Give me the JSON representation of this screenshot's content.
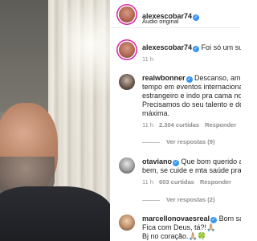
{
  "post": {
    "username": "alexescobar74",
    "subtitle": "Áudio original"
  },
  "comments": [
    {
      "username": "alexescobar74",
      "verified": true,
      "text": "Foi só um sus",
      "time": "11 h"
    },
    {
      "username": "realwbonner",
      "verified": true,
      "text_first": "Descanso, amig",
      "lines": [
        "tempo em eventos internacional",
        "estrangeiro e indo pra cama no",
        "Precisamos do seu talento e do",
        "máxima."
      ],
      "time": "11 h",
      "likes": "2.304 curtidas",
      "reply": "Responder",
      "view_replies": "Ver respostas (9)"
    },
    {
      "username": "otaviano",
      "verified": true,
      "text_first": "Que bom querido ar",
      "lines": [
        "bem, se cuide e mta saúde pra v"
      ],
      "time": "11 h",
      "likes": "603 curtidas",
      "reply": "Responder",
      "view_replies": "Ver respostas (2)"
    },
    {
      "username": "marcellonovaesreal",
      "verified": true,
      "text_first": "Bom sab",
      "lines": [
        "Fica com Deus, tá?!🙏🏼",
        "Bj no coração.🙏🏼🍀"
      ]
    }
  ]
}
